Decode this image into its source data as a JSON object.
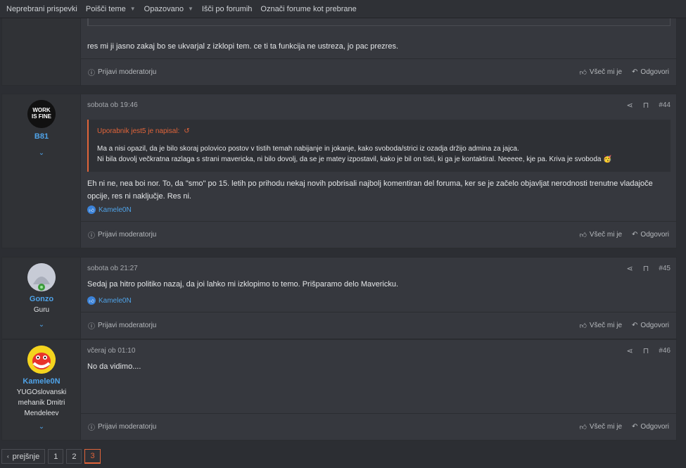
{
  "nav": {
    "items": [
      {
        "label": "Neprebrani prispevki",
        "caret": false
      },
      {
        "label": "Poišči teme",
        "caret": true
      },
      {
        "label": "Opazovano",
        "caret": true
      },
      {
        "label": "Išči po forumih",
        "caret": false
      },
      {
        "label": "Označi forume kot prebrane",
        "caret": false
      }
    ]
  },
  "posts": [
    {
      "body": "res mi ji jasno zakaj bo se ukvarjal z izklopi tem. ce ti ta funkcija ne ustreza, jo pac prezres.",
      "report": "Prijavi moderatorju",
      "like": "Všeč mi je",
      "reply": "Odgovori"
    },
    {
      "user": "B81",
      "avatar_text": "WORK IS FINE",
      "date": "sobota ob 19:46",
      "num": "#44",
      "quote_head": "Uporabnik jest5 je napisal:",
      "quote_line1": "Ma a nisi opazil, da je bilo skoraj polovico postov v tistih temah nabijanje in jokanje, kako svoboda/strici iz ozadja držijo admina za jajca.",
      "quote_line2": "Ni bila dovolj večkratna razlaga s strani mavericka, ni bilo dovolj, da se je matey izpostavil, kako je bil on tisti, ki ga je kontaktiral. Neeeee, kje pa. Kriva je svoboda",
      "body_line1": "Eh ni ne, nea boi nor. To, da \"smo\" po 15. letih po prihodu nekaj novih pobrisali najbolj komentiran del foruma, ker se je začelo objavljat nerodnosti trenutne vladajoče",
      "body_line2": "opcije, res ni naključje. Res ni.",
      "reaction": "Kamele0N",
      "report": "Prijavi moderatorju",
      "like": "Všeč mi je",
      "reply": "Odgovori"
    },
    {
      "user": "Gonzo",
      "title": "Guru",
      "date": "sobota ob 21:27",
      "num": "#45",
      "body": "Sedaj pa hitro politiko nazaj, da joi lahko mi izklopimo to temo. Prišparamo delo Mavericku.",
      "reaction": "Kamele0N",
      "report": "Prijavi moderatorju",
      "like": "Všeč mi je",
      "reply": "Odgovori"
    },
    {
      "user": "Kamele0N",
      "title_line1": "YUGOslovanski",
      "title_line2": "mehanik Dmitri",
      "title_line3": "Mendeleev",
      "date": "včeraj ob 01:10",
      "num": "#46",
      "body": "No da vidimo....",
      "report": "Prijavi moderatorju",
      "like": "Všeč mi je",
      "reply": "Odgovori"
    }
  ],
  "pager": {
    "prev": "prejšnje",
    "pages": [
      "1",
      "2",
      "3"
    ],
    "current": "3"
  },
  "icons": {
    "share": "share-icon",
    "bookmark": "bookmark-icon",
    "like": "thumbs-up-icon",
    "reply": "reply-icon",
    "report": "info-icon",
    "chevron": "chevron-down-icon"
  },
  "colors": {
    "accent": "#e0643a",
    "link": "#4fa3e8",
    "background": "#2c2e33",
    "post_bg": "#36383e"
  }
}
